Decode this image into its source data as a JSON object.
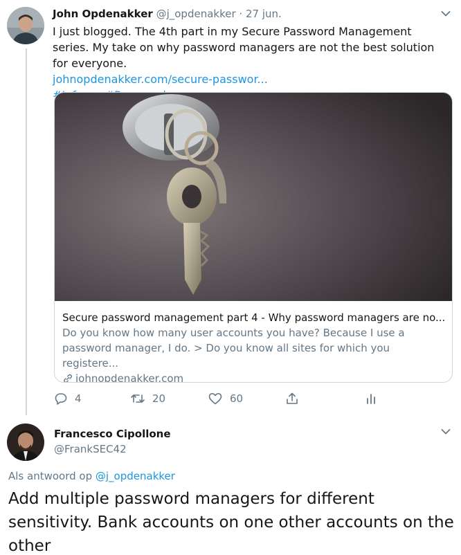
{
  "tweet1": {
    "author_name": "John Opdenakker",
    "handle": "@j_opdenakker",
    "separator": "·",
    "date": "27 jun.",
    "text": "I just blogged. The 4th part in my Secure Password Management series. My take on why password managers are not the best solution for everyone.",
    "link": "johnopdenakker.com/secure-passwor...",
    "hashtags": "#Infosec #Password",
    "card": {
      "title": "Secure password management part 4 - Why password managers are no...",
      "description": "Do you know how many user accounts you have? Because I use a password manager, I do. > Do you know all sites for which you registere...",
      "domain": "johnopdenakker.com"
    },
    "actions": {
      "reply_count": "4",
      "retweet_count": "20",
      "like_count": "60"
    }
  },
  "tweet2": {
    "author_name": "Francesco Cipollone",
    "handle": "@FrankSEC42",
    "reply_prefix": "Als antwoord op",
    "reply_to": "@j_opdenakker",
    "text": "Add multiple password managers for different sensitivity. Bank accounts on one other accounts on the other"
  },
  "icons": {
    "menu": "chevron-down-icon",
    "reply": "reply-icon",
    "retweet": "retweet-icon",
    "like": "heart-icon",
    "share": "share-icon",
    "analytics": "analytics-icon",
    "link": "link-icon"
  },
  "colors": {
    "link": "#1b95e0",
    "secondary_text": "#657786",
    "thread_line": "#ccd6dd"
  }
}
